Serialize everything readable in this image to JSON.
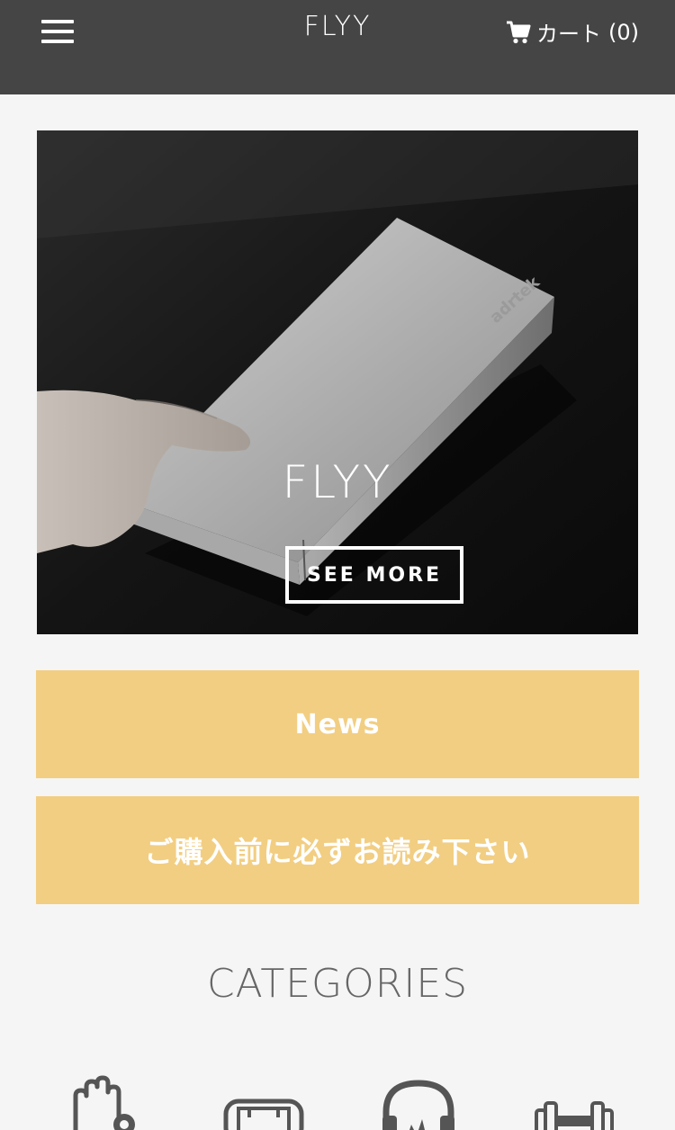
{
  "header": {
    "brand": "FLYY",
    "menu_icon": "hamburger-menu-icon",
    "cart_icon": "shopping-cart-icon",
    "cart_label": "カート",
    "cart_count": "(0)"
  },
  "hero": {
    "title": "FLYY",
    "button_label": "SEE MORE",
    "product_brand_text": "adrtek"
  },
  "banners": {
    "news": "News",
    "notice": "ご購入前に必ずお読み下さい"
  },
  "categories": {
    "title": "CATEGORIES",
    "icons": [
      "hand-gear-icon",
      "phone-case-icon",
      "headphones-icon",
      "dumbbell-icon"
    ]
  },
  "colors": {
    "header_bg": "#454545",
    "banner_bg": "#f2ce82",
    "page_bg": "#f5f5f5",
    "category_icon": "#555555"
  }
}
